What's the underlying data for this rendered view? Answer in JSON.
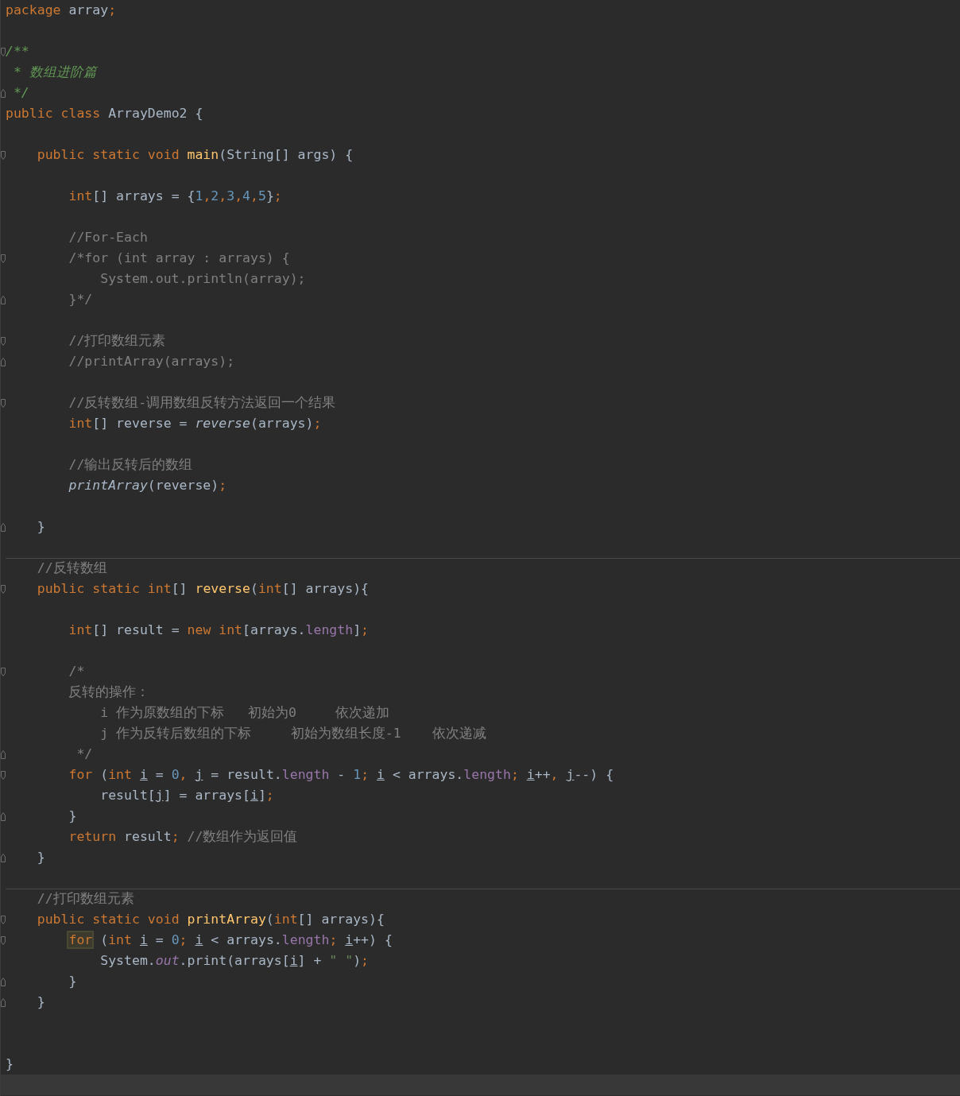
{
  "editor": {
    "lines": [
      {
        "fold_start": false,
        "fold_end": false,
        "separator": false,
        "current": false,
        "tokens": [
          {
            "text": "package",
            "kind": "keyword"
          },
          {
            "text": " array",
            "kind": "plain"
          },
          {
            "text": ";",
            "kind": "keyword"
          }
        ]
      },
      {
        "fold_start": false,
        "fold_end": false,
        "separator": false,
        "current": false
      },
      {
        "fold_start": true,
        "fold_end": false,
        "separator": false,
        "current": false,
        "tokens": [
          {
            "text": "/**",
            "kind": "doc"
          }
        ]
      },
      {
        "fold_start": false,
        "fold_end": false,
        "separator": false,
        "current": false,
        "tokens": [
          {
            "text": " * 数组进阶篇",
            "kind": "doc"
          }
        ]
      },
      {
        "fold_start": false,
        "fold_end": true,
        "separator": false,
        "current": false,
        "tokens": [
          {
            "text": " */",
            "kind": "doc"
          }
        ]
      },
      {
        "fold_start": false,
        "fold_end": false,
        "separator": false,
        "current": false,
        "tokens": [
          {
            "text": "public class",
            "kind": "keyword"
          },
          {
            "text": " ArrayDemo2 {",
            "kind": "plain"
          }
        ]
      },
      {
        "fold_start": false,
        "fold_end": false,
        "separator": false,
        "current": false
      },
      {
        "fold_start": true,
        "fold_end": false,
        "separator": false,
        "current": false,
        "tokens": [
          {
            "text": "    public static void",
            "kind": "keyword"
          },
          {
            "text": " main",
            "kind": "declaration"
          },
          {
            "text": "(String[] args) {",
            "kind": "plain"
          }
        ]
      },
      {
        "fold_start": false,
        "fold_end": false,
        "separator": false,
        "current": false
      },
      {
        "fold_start": false,
        "fold_end": false,
        "separator": false,
        "current": false,
        "tokens": [
          {
            "text": "        int",
            "kind": "keyword"
          },
          {
            "text": "[] arrays = {",
            "kind": "plain"
          },
          {
            "text": "1",
            "kind": "number"
          },
          {
            "text": ",",
            "kind": "keyword"
          },
          {
            "text": "2",
            "kind": "number"
          },
          {
            "text": ",",
            "kind": "keyword"
          },
          {
            "text": "3",
            "kind": "number"
          },
          {
            "text": ",",
            "kind": "keyword"
          },
          {
            "text": "4",
            "kind": "number"
          },
          {
            "text": ",",
            "kind": "keyword"
          },
          {
            "text": "5",
            "kind": "number"
          },
          {
            "text": "}",
            "kind": "plain"
          },
          {
            "text": ";",
            "kind": "keyword"
          }
        ]
      },
      {
        "fold_start": false,
        "fold_end": false,
        "separator": false,
        "current": false
      },
      {
        "fold_start": false,
        "fold_end": false,
        "separator": false,
        "current": false,
        "tokens": [
          {
            "text": "        //For-Each",
            "kind": "comment"
          }
        ]
      },
      {
        "fold_start": true,
        "fold_end": false,
        "separator": false,
        "current": false,
        "tokens": [
          {
            "text": "        /*for (int array : arrays) {",
            "kind": "comment"
          }
        ]
      },
      {
        "fold_start": false,
        "fold_end": false,
        "separator": false,
        "current": false,
        "tokens": [
          {
            "text": "            System.out.println(array);",
            "kind": "comment"
          }
        ]
      },
      {
        "fold_start": false,
        "fold_end": true,
        "separator": false,
        "current": false,
        "tokens": [
          {
            "text": "        }*/",
            "kind": "comment"
          }
        ]
      },
      {
        "fold_start": false,
        "fold_end": false,
        "separator": false,
        "current": false
      },
      {
        "fold_start": true,
        "fold_end": false,
        "separator": false,
        "current": false,
        "tokens": [
          {
            "text": "        //打印数组元素",
            "kind": "comment"
          }
        ]
      },
      {
        "fold_start": false,
        "fold_end": true,
        "separator": false,
        "current": false,
        "tokens": [
          {
            "text": "        //printArray(arrays);",
            "kind": "comment"
          }
        ]
      },
      {
        "fold_start": false,
        "fold_end": false,
        "separator": false,
        "current": false
      },
      {
        "fold_start": true,
        "fold_end": false,
        "separator": false,
        "current": false,
        "tokens": [
          {
            "text": "        //反转数组-调用数组反转方法返回一个结果",
            "kind": "comment"
          }
        ]
      },
      {
        "fold_start": false,
        "fold_end": false,
        "separator": false,
        "current": false,
        "tokens": [
          {
            "text": "        int",
            "kind": "keyword"
          },
          {
            "text": "[] reverse = ",
            "kind": "plain"
          },
          {
            "text": "reverse",
            "kind": "call"
          },
          {
            "text": "(arrays)",
            "kind": "plain"
          },
          {
            "text": ";",
            "kind": "keyword"
          }
        ]
      },
      {
        "fold_start": false,
        "fold_end": false,
        "separator": false,
        "current": false
      },
      {
        "fold_start": false,
        "fold_end": false,
        "separator": false,
        "current": false,
        "tokens": [
          {
            "text": "        //输出反转后的数组",
            "kind": "comment"
          }
        ]
      },
      {
        "fold_start": false,
        "fold_end": false,
        "separator": false,
        "current": false,
        "tokens": [
          {
            "text": "        printArray",
            "kind": "call"
          },
          {
            "text": "(reverse)",
            "kind": "plain"
          },
          {
            "text": ";",
            "kind": "keyword"
          }
        ]
      },
      {
        "fold_start": false,
        "fold_end": false,
        "separator": false,
        "current": false
      },
      {
        "fold_start": false,
        "fold_end": true,
        "separator": false,
        "current": false,
        "tokens": [
          {
            "text": "    }",
            "kind": "plain"
          }
        ]
      },
      {
        "fold_start": false,
        "fold_end": false,
        "separator": false,
        "current": false
      },
      {
        "fold_start": false,
        "fold_end": false,
        "separator": true,
        "current": false,
        "tokens": [
          {
            "text": "    //反转数组",
            "kind": "comment"
          }
        ]
      },
      {
        "fold_start": true,
        "fold_end": false,
        "separator": false,
        "current": false,
        "tokens": [
          {
            "text": "    public static int",
            "kind": "keyword"
          },
          {
            "text": "[] ",
            "kind": "plain"
          },
          {
            "text": "reverse",
            "kind": "declaration"
          },
          {
            "text": "(",
            "kind": "plain"
          },
          {
            "text": "int",
            "kind": "keyword"
          },
          {
            "text": "[] arrays){",
            "kind": "plain"
          }
        ]
      },
      {
        "fold_start": false,
        "fold_end": false,
        "separator": false,
        "current": false
      },
      {
        "fold_start": false,
        "fold_end": false,
        "separator": false,
        "current": false,
        "tokens": [
          {
            "text": "        int",
            "kind": "keyword"
          },
          {
            "text": "[] result = ",
            "kind": "plain"
          },
          {
            "text": "new int",
            "kind": "keyword"
          },
          {
            "text": "[arrays.",
            "kind": "plain"
          },
          {
            "text": "length",
            "kind": "field"
          },
          {
            "text": "]",
            "kind": "plain"
          },
          {
            "text": ";",
            "kind": "keyword"
          }
        ]
      },
      {
        "fold_start": false,
        "fold_end": false,
        "separator": false,
        "current": false
      },
      {
        "fold_start": true,
        "fold_end": false,
        "separator": false,
        "current": false,
        "tokens": [
          {
            "text": "        /*",
            "kind": "comment"
          }
        ]
      },
      {
        "fold_start": false,
        "fold_end": false,
        "separator": false,
        "current": false,
        "tokens": [
          {
            "text": "        反转的操作：",
            "kind": "comment"
          }
        ]
      },
      {
        "fold_start": false,
        "fold_end": false,
        "separator": false,
        "current": false,
        "tokens": [
          {
            "text": "            i 作为原数组的下标   初始为0     依次递加",
            "kind": "comment"
          }
        ]
      },
      {
        "fold_start": false,
        "fold_end": false,
        "separator": false,
        "current": false,
        "tokens": [
          {
            "text": "            j 作为反转后数组的下标     初始为数组长度-1    依次递减",
            "kind": "comment"
          }
        ]
      },
      {
        "fold_start": false,
        "fold_end": true,
        "separator": false,
        "current": false,
        "tokens": [
          {
            "text": "         */",
            "kind": "comment"
          }
        ]
      },
      {
        "fold_start": true,
        "fold_end": false,
        "separator": false,
        "current": false,
        "tokens": [
          {
            "text": "        for",
            "kind": "keyword"
          },
          {
            "text": " (",
            "kind": "plain"
          },
          {
            "text": "int",
            "kind": "keyword"
          },
          {
            "text": " i",
            "kind": "variable"
          },
          {
            "text": " = ",
            "kind": "plain"
          },
          {
            "text": "0",
            "kind": "number"
          },
          {
            "text": ",",
            "kind": "keyword"
          },
          {
            "text": " j",
            "kind": "variable"
          },
          {
            "text": " = result.",
            "kind": "plain"
          },
          {
            "text": "length",
            "kind": "field"
          },
          {
            "text": " - ",
            "kind": "plain"
          },
          {
            "text": "1",
            "kind": "number"
          },
          {
            "text": ";",
            "kind": "keyword"
          },
          {
            "text": " i",
            "kind": "variable"
          },
          {
            "text": " < arrays.",
            "kind": "plain"
          },
          {
            "text": "length",
            "kind": "field"
          },
          {
            "text": ";",
            "kind": "keyword"
          },
          {
            "text": " i",
            "kind": "variable"
          },
          {
            "text": "++",
            "kind": "plain"
          },
          {
            "text": ",",
            "kind": "keyword"
          },
          {
            "text": " j",
            "kind": "variable"
          },
          {
            "text": "--) {",
            "kind": "plain"
          }
        ]
      },
      {
        "fold_start": false,
        "fold_end": false,
        "separator": false,
        "current": false,
        "tokens": [
          {
            "text": "            result[",
            "kind": "plain"
          },
          {
            "text": "j",
            "kind": "variable"
          },
          {
            "text": "] = arrays[",
            "kind": "plain"
          },
          {
            "text": "i",
            "kind": "variable"
          },
          {
            "text": "]",
            "kind": "plain"
          },
          {
            "text": ";",
            "kind": "keyword"
          }
        ]
      },
      {
        "fold_start": false,
        "fold_end": true,
        "separator": false,
        "current": false,
        "tokens": [
          {
            "text": "        }",
            "kind": "plain"
          }
        ]
      },
      {
        "fold_start": false,
        "fold_end": false,
        "separator": false,
        "current": false,
        "tokens": [
          {
            "text": "        return",
            "kind": "keyword"
          },
          {
            "text": " result",
            "kind": "plain"
          },
          {
            "text": ";",
            "kind": "keyword"
          },
          {
            "text": " //数组作为返回值",
            "kind": "comment"
          }
        ]
      },
      {
        "fold_start": false,
        "fold_end": true,
        "separator": false,
        "current": false,
        "tokens": [
          {
            "text": "    }",
            "kind": "plain"
          }
        ]
      },
      {
        "fold_start": false,
        "fold_end": false,
        "separator": false,
        "current": false
      },
      {
        "fold_start": false,
        "fold_end": false,
        "separator": true,
        "current": false,
        "tokens": [
          {
            "text": "    //打印数组元素",
            "kind": "comment"
          }
        ]
      },
      {
        "fold_start": true,
        "fold_end": false,
        "separator": false,
        "current": false,
        "tokens": [
          {
            "text": "    public static void",
            "kind": "keyword"
          },
          {
            "text": " printArray",
            "kind": "declaration"
          },
          {
            "text": "(",
            "kind": "plain"
          },
          {
            "text": "int",
            "kind": "keyword"
          },
          {
            "text": "[] arrays){",
            "kind": "plain"
          }
        ]
      },
      {
        "fold_start": true,
        "fold_end": false,
        "separator": false,
        "current": false,
        "tokens": [
          {
            "text": "        for",
            "kind": "matched-keyword"
          },
          {
            "text": " (",
            "kind": "plain"
          },
          {
            "text": "int",
            "kind": "keyword"
          },
          {
            "text": " i",
            "kind": "variable"
          },
          {
            "text": " = ",
            "kind": "plain"
          },
          {
            "text": "0",
            "kind": "number"
          },
          {
            "text": ";",
            "kind": "keyword"
          },
          {
            "text": " i",
            "kind": "variable"
          },
          {
            "text": " < arrays.",
            "kind": "plain"
          },
          {
            "text": "length",
            "kind": "field"
          },
          {
            "text": ";",
            "kind": "keyword"
          },
          {
            "text": " i",
            "kind": "variable"
          },
          {
            "text": "++) {",
            "kind": "plain"
          }
        ]
      },
      {
        "fold_start": false,
        "fold_end": false,
        "separator": false,
        "current": false,
        "tokens": [
          {
            "text": "            System.",
            "kind": "plain"
          },
          {
            "text": "out",
            "kind": "static-field"
          },
          {
            "text": ".print(arrays[",
            "kind": "plain"
          },
          {
            "text": "i",
            "kind": "variable"
          },
          {
            "text": "] + ",
            "kind": "plain"
          },
          {
            "text": "\" \"",
            "kind": "string"
          },
          {
            "text": ")",
            "kind": "plain"
          },
          {
            "text": ";",
            "kind": "keyword"
          }
        ]
      },
      {
        "fold_start": false,
        "fold_end": true,
        "separator": false,
        "current": false,
        "tokens": [
          {
            "text": "        }",
            "kind": "plain"
          }
        ]
      },
      {
        "fold_start": false,
        "fold_end": true,
        "separator": false,
        "current": false,
        "tokens": [
          {
            "text": "    }",
            "kind": "plain"
          }
        ]
      },
      {
        "fold_start": false,
        "fold_end": false,
        "separator": false,
        "current": false
      },
      {
        "fold_start": false,
        "fold_end": false,
        "separator": false,
        "current": false
      },
      {
        "fold_start": false,
        "fold_end": false,
        "separator": false,
        "current": false,
        "tokens": [
          {
            "text": "}",
            "kind": "plain"
          }
        ]
      },
      {
        "fold_start": false,
        "fold_end": false,
        "separator": false,
        "current": true
      }
    ]
  }
}
